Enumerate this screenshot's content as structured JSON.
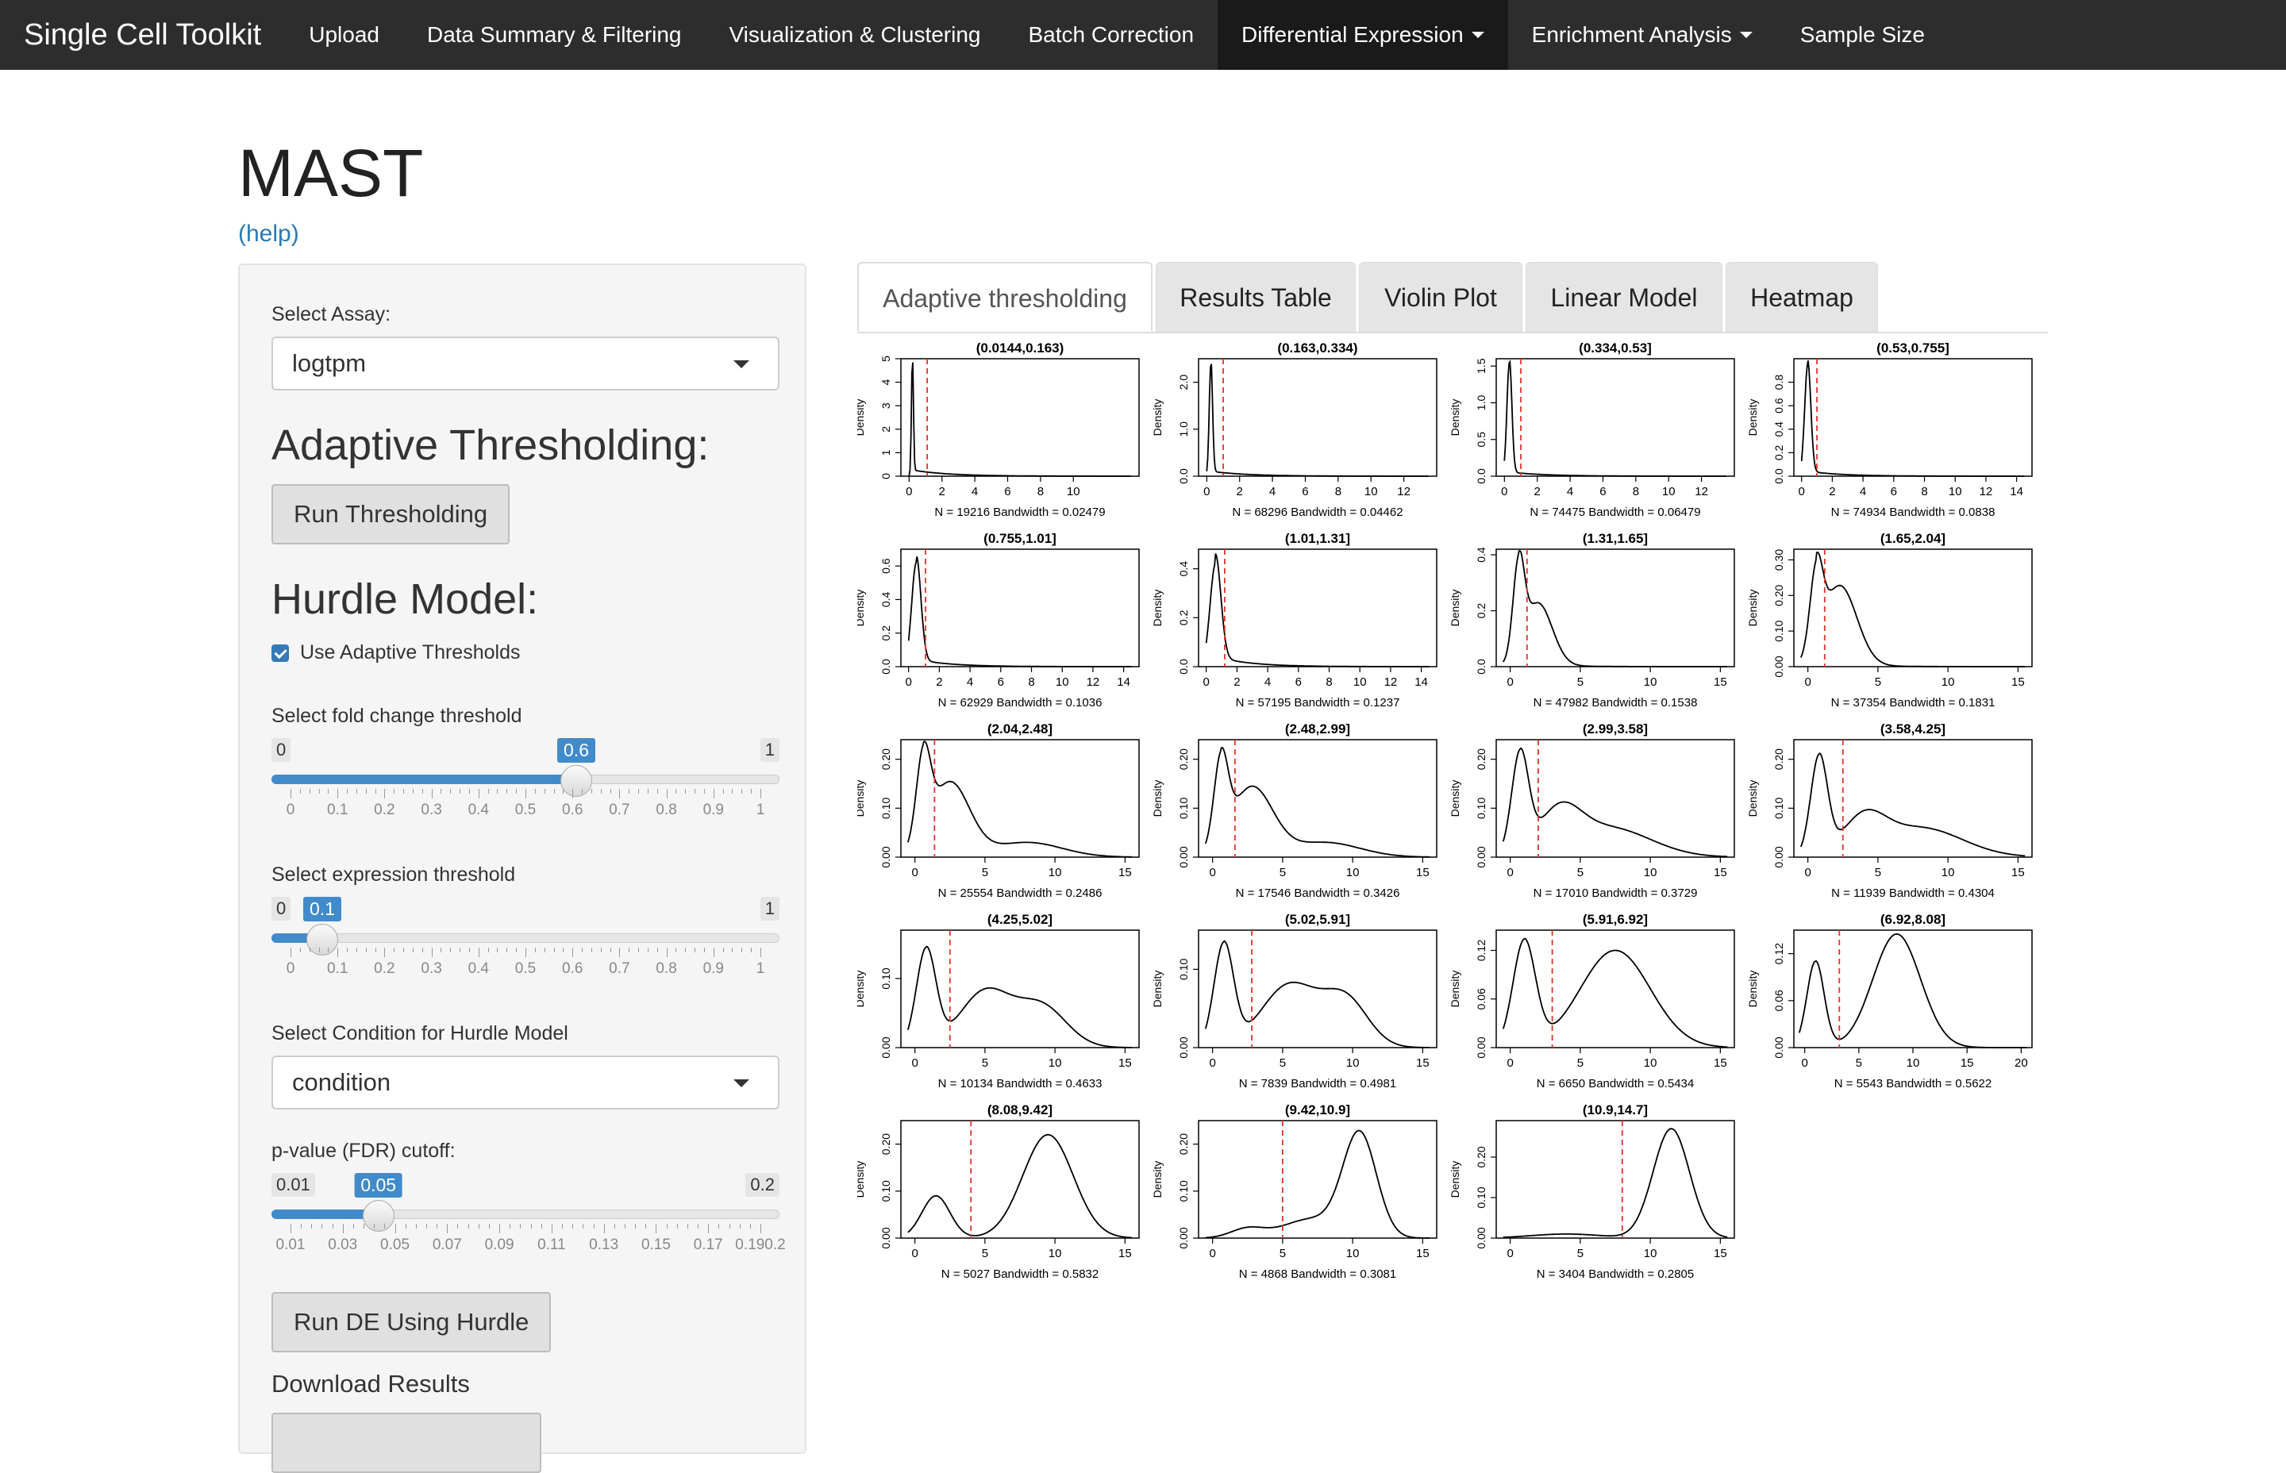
{
  "navbar": {
    "brand": "Single Cell Toolkit",
    "items": [
      {
        "label": "Upload",
        "dropdown": false
      },
      {
        "label": "Data Summary & Filtering",
        "dropdown": false
      },
      {
        "label": "Visualization & Clustering",
        "dropdown": false
      },
      {
        "label": "Batch Correction",
        "dropdown": false
      },
      {
        "label": "Differential Expression",
        "dropdown": true,
        "active": true
      },
      {
        "label": "Enrichment Analysis",
        "dropdown": true
      },
      {
        "label": "Sample Size",
        "dropdown": false
      }
    ]
  },
  "page": {
    "title": "MAST",
    "help": "(help)"
  },
  "sidebar": {
    "assay_label": "Select Assay:",
    "assay_value": "logtpm",
    "adaptive_heading": "Adaptive Thresholding:",
    "run_threshold_button": "Run Thresholding",
    "hurdle_heading": "Hurdle Model:",
    "use_adaptive_label": "Use Adaptive Thresholds",
    "use_adaptive_checked": true,
    "fold_change": {
      "label": "Select fold change threshold",
      "min": "0",
      "max": "1",
      "value": "0.6",
      "fraction": 0.6,
      "ticks": [
        "0",
        "0.1",
        "0.2",
        "0.3",
        "0.4",
        "0.5",
        "0.6",
        "0.7",
        "0.8",
        "0.9",
        "1"
      ]
    },
    "expression": {
      "label": "Select expression threshold",
      "min": "0",
      "max": "1",
      "value": "0.1",
      "fraction": 0.1,
      "ticks": [
        "0",
        "0.1",
        "0.2",
        "0.3",
        "0.4",
        "0.5",
        "0.6",
        "0.7",
        "0.8",
        "0.9",
        "1"
      ]
    },
    "condition_label": "Select Condition for Hurdle Model",
    "condition_value": "condition",
    "pvalue": {
      "label": "p-value (FDR) cutoff:",
      "min": "0.01",
      "max": "0.2",
      "value": "0.05",
      "fraction": 0.2105,
      "ticks": [
        "0.01",
        "0.03",
        "0.05",
        "0.07",
        "0.09",
        "0.11",
        "0.13",
        "0.15",
        "0.17",
        "0.190.2"
      ]
    },
    "run_de_button": "Run DE Using Hurdle",
    "download_label": "Download Results"
  },
  "tabs": [
    {
      "label": "Adaptive thresholding",
      "active": true
    },
    {
      "label": "Results Table"
    },
    {
      "label": "Violin Plot"
    },
    {
      "label": "Linear Model"
    },
    {
      "label": "Heatmap"
    }
  ],
  "chart_data": [
    {
      "type": "line",
      "title": "(0.0144,0.163)",
      "ylabel": "Density",
      "xticks": [
        "0",
        "2",
        "4",
        "6",
        "8",
        "10"
      ],
      "yticks": [
        "0",
        "1",
        "2",
        "3",
        "4",
        "5"
      ],
      "xlim": [
        -0.5,
        14
      ],
      "ylim": [
        0,
        5
      ],
      "threshold": 1.1,
      "caption": "N = 19216   Bandwidth = 0.02479",
      "peaks": [
        {
          "mu": 0.2,
          "sd": 0.06,
          "h": 5
        }
      ],
      "tail": 0.15
    },
    {
      "type": "line",
      "title": "(0.163,0.334)",
      "ylabel": "Density",
      "xticks": [
        "0",
        "2",
        "4",
        "6",
        "8",
        "10",
        "12"
      ],
      "yticks": [
        "0.0",
        "1.0",
        "2.0"
      ],
      "xlim": [
        -0.5,
        14
      ],
      "ylim": [
        0,
        2.5
      ],
      "threshold": 1.0,
      "caption": "N = 68296   Bandwidth = 0.04462",
      "peaks": [
        {
          "mu": 0.25,
          "sd": 0.1,
          "h": 2.4
        }
      ],
      "tail": 0.12
    },
    {
      "type": "line",
      "title": "(0.334,0.53]",
      "ylabel": "Density",
      "xticks": [
        "0",
        "2",
        "4",
        "6",
        "8",
        "10",
        "12"
      ],
      "yticks": [
        "0.0",
        "0.5",
        "1.0",
        "1.5"
      ],
      "xlim": [
        -0.5,
        14
      ],
      "ylim": [
        0,
        1.6
      ],
      "threshold": 1.0,
      "caption": "N = 74475   Bandwidth = 0.06479",
      "peaks": [
        {
          "mu": 0.3,
          "sd": 0.15,
          "h": 1.55
        }
      ],
      "tail": 0.1
    },
    {
      "type": "line",
      "title": "(0.53,0.755]",
      "ylabel": "Density",
      "xticks": [
        "0",
        "2",
        "4",
        "6",
        "8",
        "10",
        "12",
        "14"
      ],
      "yticks": [
        "0.0",
        "0.2",
        "0.4",
        "0.6",
        "0.8"
      ],
      "xlim": [
        -0.5,
        15
      ],
      "ylim": [
        0,
        1.0
      ],
      "threshold": 1.0,
      "caption": "N = 74934   Bandwidth = 0.0838",
      "peaks": [
        {
          "mu": 0.4,
          "sd": 0.2,
          "h": 0.95
        }
      ],
      "tail": 0.12
    },
    {
      "type": "line",
      "title": "(0.755,1.01]",
      "ylabel": "Density",
      "xticks": [
        "0",
        "2",
        "4",
        "6",
        "8",
        "10",
        "12",
        "14"
      ],
      "yticks": [
        "0.0",
        "0.2",
        "0.4",
        "0.6"
      ],
      "xlim": [
        -0.5,
        15
      ],
      "ylim": [
        0,
        0.7
      ],
      "threshold": 1.1,
      "caption": "N = 62929   Bandwidth = 0.1036",
      "peaks": [
        {
          "mu": 0.5,
          "sd": 0.3,
          "h": 0.62
        }
      ],
      "tail": 0.18
    },
    {
      "type": "line",
      "title": "(1.01,1.31]",
      "ylabel": "Density",
      "xticks": [
        "0",
        "2",
        "4",
        "6",
        "8",
        "10",
        "12",
        "14"
      ],
      "yticks": [
        "0.0",
        "0.2",
        "0.4"
      ],
      "xlim": [
        -0.5,
        15
      ],
      "ylim": [
        0,
        0.48
      ],
      "threshold": 1.2,
      "caption": "N = 57195   Bandwidth = 0.1237",
      "peaks": [
        {
          "mu": 0.6,
          "sd": 0.35,
          "h": 0.42
        }
      ],
      "tail": 0.25
    },
    {
      "type": "line",
      "title": "(1.31,1.65]",
      "ylabel": "Density",
      "xticks": [
        "0",
        "5",
        "10",
        "15"
      ],
      "yticks": [
        "0.0",
        "0.2",
        "0.4"
      ],
      "xlim": [
        -1,
        16
      ],
      "ylim": [
        0,
        0.42
      ],
      "threshold": 1.2,
      "caption": "N = 47982   Bandwidth = 0.1538",
      "peaks": [
        {
          "mu": 0.6,
          "sd": 0.4,
          "h": 0.32
        },
        {
          "mu": 2,
          "sd": 1.0,
          "h": 0.22
        }
      ],
      "tail": 0.1
    },
    {
      "type": "line",
      "title": "(1.65,2.04]",
      "ylabel": "Density",
      "xticks": [
        "0",
        "5",
        "10",
        "15"
      ],
      "yticks": [
        "0.00",
        "0.10",
        "0.20",
        "0.30"
      ],
      "xlim": [
        -1,
        16
      ],
      "ylim": [
        0,
        0.33
      ],
      "threshold": 1.2,
      "caption": "N = 37354   Bandwidth = 0.1831",
      "peaks": [
        {
          "mu": 0.6,
          "sd": 0.45,
          "h": 0.22
        },
        {
          "mu": 2.3,
          "sd": 1.2,
          "h": 0.22
        }
      ],
      "tail": 0.15
    },
    {
      "type": "line",
      "title": "(2.04,2.48]",
      "ylabel": "Density",
      "xticks": [
        "0",
        "5",
        "10",
        "15"
      ],
      "yticks": [
        "0.00",
        "0.10",
        "0.20"
      ],
      "xlim": [
        -1,
        16
      ],
      "ylim": [
        0,
        0.24
      ],
      "threshold": 1.4,
      "caption": "N = 25554   Bandwidth = 0.2486",
      "peaks": [
        {
          "mu": 0.6,
          "sd": 0.5,
          "h": 0.17
        },
        {
          "mu": 2.5,
          "sd": 1.4,
          "h": 0.15
        },
        {
          "mu": 8,
          "sd": 2.5,
          "h": 0.03
        }
      ],
      "tail": 0.05
    },
    {
      "type": "line",
      "title": "(2.48,2.99]",
      "ylabel": "Density",
      "xticks": [
        "0",
        "5",
        "10",
        "15"
      ],
      "yticks": [
        "0.00",
        "0.10",
        "0.20"
      ],
      "xlim": [
        -1,
        16
      ],
      "ylim": [
        0,
        0.24
      ],
      "threshold": 1.6,
      "caption": "N = 17546   Bandwidth = 0.3426",
      "peaks": [
        {
          "mu": 0.6,
          "sd": 0.5,
          "h": 0.17
        },
        {
          "mu": 2.8,
          "sd": 1.5,
          "h": 0.14
        },
        {
          "mu": 8,
          "sd": 2.5,
          "h": 0.03
        }
      ],
      "tail": 0.05
    },
    {
      "type": "line",
      "title": "(2.99,3.58]",
      "ylabel": "Density",
      "xticks": [
        "0",
        "5",
        "10",
        "15"
      ],
      "yticks": [
        "0.00",
        "0.10",
        "0.20"
      ],
      "xlim": [
        -1,
        16
      ],
      "ylim": [
        0,
        0.24
      ],
      "threshold": 2.0,
      "caption": "N = 17010   Bandwidth = 0.3729",
      "peaks": [
        {
          "mu": 0.7,
          "sd": 0.6,
          "h": 0.2
        },
        {
          "mu": 3.5,
          "sd": 1.5,
          "h": 0.08
        },
        {
          "mu": 7,
          "sd": 3,
          "h": 0.06
        }
      ],
      "tail": 0.02
    },
    {
      "type": "line",
      "title": "(3.58,4.25]",
      "ylabel": "Density",
      "xticks": [
        "0",
        "5",
        "10",
        "15"
      ],
      "yticks": [
        "0.00",
        "0.10",
        "0.20"
      ],
      "xlim": [
        -1,
        16
      ],
      "ylim": [
        0,
        0.24
      ],
      "threshold": 2.5,
      "caption": "N = 11939   Bandwidth = 0.4304",
      "peaks": [
        {
          "mu": 0.8,
          "sd": 0.6,
          "h": 0.2
        },
        {
          "mu": 4,
          "sd": 1.5,
          "h": 0.07
        },
        {
          "mu": 8,
          "sd": 3,
          "h": 0.06
        }
      ],
      "tail": 0.02
    },
    {
      "type": "line",
      "title": "(4.25,5.02]",
      "ylabel": "Density",
      "xticks": [
        "0",
        "5",
        "10",
        "15"
      ],
      "yticks": [
        "0.00",
        "0.10"
      ],
      "xlim": [
        -1,
        16
      ],
      "ylim": [
        0,
        0.17
      ],
      "threshold": 2.5,
      "caption": "N = 10134   Bandwidth = 0.4633",
      "peaks": [
        {
          "mu": 0.8,
          "sd": 0.7,
          "h": 0.14
        },
        {
          "mu": 5,
          "sd": 1.8,
          "h": 0.08
        },
        {
          "mu": 9,
          "sd": 1.8,
          "h": 0.06
        }
      ],
      "tail": 0.02
    },
    {
      "type": "line",
      "title": "(5.02,5.91]",
      "ylabel": "Density",
      "xticks": [
        "0",
        "5",
        "10",
        "15"
      ],
      "yticks": [
        "0.00",
        "0.10"
      ],
      "xlim": [
        -1,
        16
      ],
      "ylim": [
        0,
        0.15
      ],
      "threshold": 2.8,
      "caption": "N = 7839   Bandwidth = 0.4981",
      "peaks": [
        {
          "mu": 0.8,
          "sd": 0.7,
          "h": 0.13
        },
        {
          "mu": 5.5,
          "sd": 2,
          "h": 0.08
        },
        {
          "mu": 9.5,
          "sd": 1.6,
          "h": 0.06
        }
      ],
      "tail": 0.02
    },
    {
      "type": "line",
      "title": "(5.91,6.92]",
      "ylabel": "Density",
      "xticks": [
        "0",
        "5",
        "10",
        "15"
      ],
      "yticks": [
        "0.00",
        "0.06",
        "0.12"
      ],
      "xlim": [
        -1,
        16
      ],
      "ylim": [
        0,
        0.145
      ],
      "threshold": 3.0,
      "caption": "N = 6650   Bandwidth = 0.5434",
      "peaks": [
        {
          "mu": 1,
          "sd": 0.8,
          "h": 0.13
        },
        {
          "mu": 7.5,
          "sd": 2.5,
          "h": 0.12
        }
      ],
      "tail": 0.01
    },
    {
      "type": "line",
      "title": "(6.92,8.08]",
      "ylabel": "Density",
      "xticks": [
        "0",
        "5",
        "10",
        "15",
        "20"
      ],
      "yticks": [
        "0.00",
        "0.06",
        "0.12"
      ],
      "xlim": [
        -1,
        21
      ],
      "ylim": [
        0,
        0.15
      ],
      "threshold": 3.2,
      "caption": "N = 5543   Bandwidth = 0.5622",
      "peaks": [
        {
          "mu": 1,
          "sd": 0.8,
          "h": 0.11
        },
        {
          "mu": 8.5,
          "sd": 2.2,
          "h": 0.145
        }
      ],
      "tail": 0.01
    },
    {
      "type": "line",
      "title": "(8.08,9.42]",
      "ylabel": "Density",
      "xticks": [
        "0",
        "5",
        "10",
        "15"
      ],
      "yticks": [
        "0.00",
        "0.10",
        "0.20"
      ],
      "xlim": [
        -1,
        16
      ],
      "ylim": [
        0,
        0.25
      ],
      "threshold": 4.0,
      "caption": "N = 5027   Bandwidth = 0.5832",
      "peaks": [
        {
          "mu": 1.5,
          "sd": 1.0,
          "h": 0.09
        },
        {
          "mu": 9.5,
          "sd": 1.8,
          "h": 0.22
        }
      ],
      "tail": 0.0
    },
    {
      "type": "line",
      "title": "(9.42,10.9]",
      "ylabel": "Density",
      "xticks": [
        "0",
        "5",
        "10",
        "15"
      ],
      "yticks": [
        "0.00",
        "0.10",
        "0.20"
      ],
      "xlim": [
        -1,
        16
      ],
      "ylim": [
        0,
        0.25
      ],
      "threshold": 5.0,
      "caption": "N = 4868   Bandwidth = 0.3081",
      "peaks": [
        {
          "mu": 2.5,
          "sd": 1.2,
          "h": 0.02
        },
        {
          "mu": 7,
          "sd": 2,
          "h": 0.04
        },
        {
          "mu": 10.5,
          "sd": 1.2,
          "h": 0.22
        }
      ],
      "tail": 0.0
    },
    {
      "type": "line",
      "title": "(10.9,14.7]",
      "ylabel": "Density",
      "xticks": [
        "0",
        "5",
        "10",
        "15"
      ],
      "yticks": [
        "0.00",
        "0.10",
        "0.20"
      ],
      "xlim": [
        -1,
        16
      ],
      "ylim": [
        0,
        0.29
      ],
      "threshold": 8.0,
      "caption": "N = 3404   Bandwidth = 0.2805",
      "peaks": [
        {
          "mu": 4,
          "sd": 2.5,
          "h": 0.01
        },
        {
          "mu": 11.5,
          "sd": 1.3,
          "h": 0.27
        }
      ],
      "tail": 0.0
    }
  ]
}
